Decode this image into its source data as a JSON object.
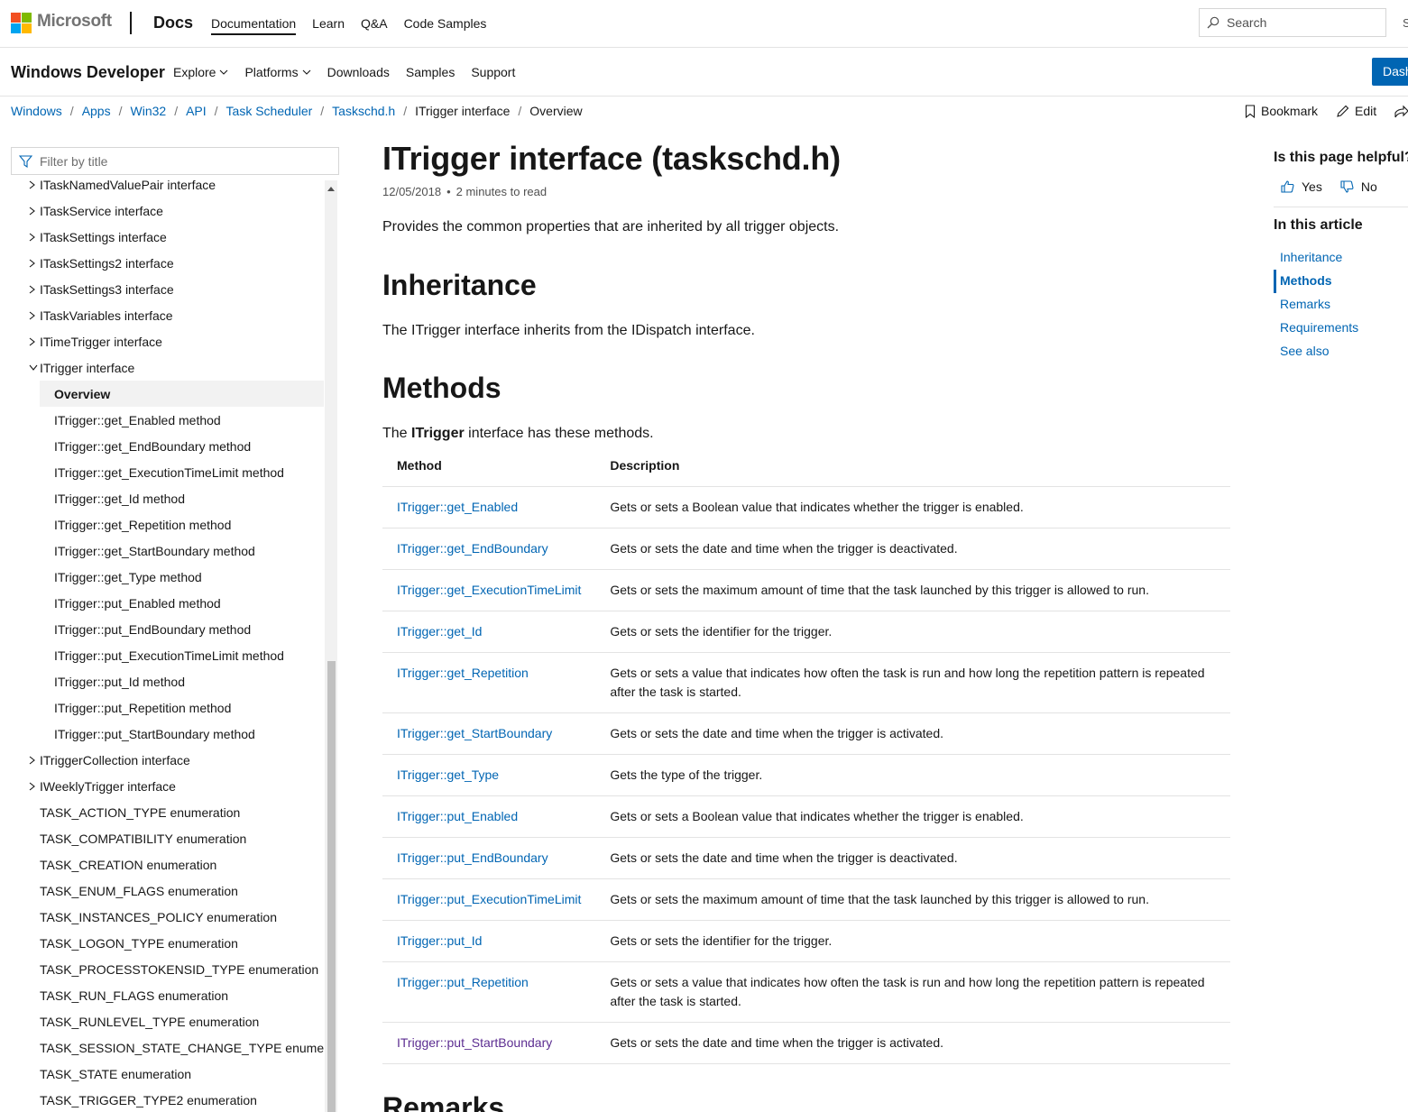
{
  "top_header": {
    "brand": "Microsoft",
    "product": "Docs",
    "nav": [
      "Documentation",
      "Learn",
      "Q&A",
      "Code Samples"
    ],
    "search_placeholder": "Search",
    "sign_in_partial": "S"
  },
  "sub_header": {
    "site_title": "Windows Developer",
    "nav": [
      {
        "label": "Explore",
        "dropdown": true
      },
      {
        "label": "Platforms",
        "dropdown": true
      },
      {
        "label": "Downloads",
        "dropdown": false
      },
      {
        "label": "Samples",
        "dropdown": false
      },
      {
        "label": "Support",
        "dropdown": false
      }
    ],
    "dashboard_label": "Dash"
  },
  "breadcrumb": [
    "Windows",
    "Apps",
    "Win32",
    "API",
    "Task Scheduler",
    "Taskschd.h",
    "ITrigger interface",
    "Overview"
  ],
  "actions": {
    "bookmark": "Bookmark",
    "edit": "Edit"
  },
  "toc": {
    "filter_placeholder": "Filter by title",
    "items": [
      {
        "label": "ITaskNamedValuePair interface",
        "level": 1,
        "expand": "collapsed"
      },
      {
        "label": "ITaskService interface",
        "level": 1,
        "expand": "collapsed"
      },
      {
        "label": "ITaskSettings interface",
        "level": 1,
        "expand": "collapsed"
      },
      {
        "label": "ITaskSettings2 interface",
        "level": 1,
        "expand": "collapsed"
      },
      {
        "label": "ITaskSettings3 interface",
        "level": 1,
        "expand": "collapsed"
      },
      {
        "label": "ITaskVariables interface",
        "level": 1,
        "expand": "collapsed"
      },
      {
        "label": "ITimeTrigger interface",
        "level": 1,
        "expand": "collapsed"
      },
      {
        "label": "ITrigger interface",
        "level": 1,
        "expand": "expanded"
      },
      {
        "label": "Overview",
        "level": 2,
        "selected": true
      },
      {
        "label": "ITrigger::get_Enabled method",
        "level": 2
      },
      {
        "label": "ITrigger::get_EndBoundary method",
        "level": 2
      },
      {
        "label": "ITrigger::get_ExecutionTimeLimit method",
        "level": 2
      },
      {
        "label": "ITrigger::get_Id method",
        "level": 2
      },
      {
        "label": "ITrigger::get_Repetition method",
        "level": 2
      },
      {
        "label": "ITrigger::get_StartBoundary method",
        "level": 2
      },
      {
        "label": "ITrigger::get_Type method",
        "level": 2
      },
      {
        "label": "ITrigger::put_Enabled method",
        "level": 2
      },
      {
        "label": "ITrigger::put_EndBoundary method",
        "level": 2
      },
      {
        "label": "ITrigger::put_ExecutionTimeLimit method",
        "level": 2
      },
      {
        "label": "ITrigger::put_Id method",
        "level": 2
      },
      {
        "label": "ITrigger::put_Repetition method",
        "level": 2
      },
      {
        "label": "ITrigger::put_StartBoundary method",
        "level": 2
      },
      {
        "label": "ITriggerCollection interface",
        "level": 1,
        "expand": "collapsed"
      },
      {
        "label": "IWeeklyTrigger interface",
        "level": 1,
        "expand": "collapsed"
      },
      {
        "label": "TASK_ACTION_TYPE enumeration",
        "level": 1,
        "expand": "none"
      },
      {
        "label": "TASK_COMPATIBILITY enumeration",
        "level": 1,
        "expand": "none"
      },
      {
        "label": "TASK_CREATION enumeration",
        "level": 1,
        "expand": "none"
      },
      {
        "label": "TASK_ENUM_FLAGS enumeration",
        "level": 1,
        "expand": "none"
      },
      {
        "label": "TASK_INSTANCES_POLICY enumeration",
        "level": 1,
        "expand": "none"
      },
      {
        "label": "TASK_LOGON_TYPE enumeration",
        "level": 1,
        "expand": "none"
      },
      {
        "label": "TASK_PROCESSTOKENSID_TYPE enumeration",
        "level": 1,
        "expand": "none"
      },
      {
        "label": "TASK_RUN_FLAGS enumeration",
        "level": 1,
        "expand": "none"
      },
      {
        "label": "TASK_RUNLEVEL_TYPE enumeration",
        "level": 1,
        "expand": "none"
      },
      {
        "label": "TASK_SESSION_STATE_CHANGE_TYPE enumeration",
        "level": 1,
        "expand": "none"
      },
      {
        "label": "TASK_STATE enumeration",
        "level": 1,
        "expand": "none"
      },
      {
        "label": "TASK_TRIGGER_TYPE2 enumeration",
        "level": 1,
        "expand": "none"
      }
    ]
  },
  "article": {
    "title": "ITrigger interface (taskschd.h)",
    "date": "12/05/2018",
    "read_time": "2 minutes to read",
    "lead": "Provides the common properties that are inherited by all trigger objects.",
    "inheritance_heading": "Inheritance",
    "inheritance_text": "The ITrigger interface inherits from the IDispatch interface.",
    "methods_heading": "Methods",
    "methods_intro_pre": "The ",
    "methods_intro_bold": "ITrigger",
    "methods_intro_post": " interface has these methods.",
    "table_headers": [
      "Method",
      "Description"
    ],
    "methods": [
      {
        "name": "ITrigger::get_Enabled",
        "desc": "Gets or sets a Boolean value that indicates whether the trigger is enabled."
      },
      {
        "name": "ITrigger::get_EndBoundary",
        "desc": "Gets or sets the date and time when the trigger is deactivated."
      },
      {
        "name": "ITrigger::get_ExecutionTimeLimit",
        "desc": "Gets or sets the maximum amount of time that the task launched by this trigger is allowed to run."
      },
      {
        "name": "ITrigger::get_Id",
        "desc": "Gets or sets the identifier for the trigger."
      },
      {
        "name": "ITrigger::get_Repetition",
        "desc": "Gets or sets a value that indicates how often the task is run and how long the repetition pattern is repeated after the task is started."
      },
      {
        "name": "ITrigger::get_StartBoundary",
        "desc": "Gets or sets the date and time when the trigger is activated."
      },
      {
        "name": "ITrigger::get_Type",
        "desc": "Gets the type of the trigger."
      },
      {
        "name": "ITrigger::put_Enabled",
        "desc": "Gets or sets a Boolean value that indicates whether the trigger is enabled."
      },
      {
        "name": "ITrigger::put_EndBoundary",
        "desc": "Gets or sets the date and time when the trigger is deactivated."
      },
      {
        "name": "ITrigger::put_ExecutionTimeLimit",
        "desc": "Gets or sets the maximum amount of time that the task launched by this trigger is allowed to run."
      },
      {
        "name": "ITrigger::put_Id",
        "desc": "Gets or sets the identifier for the trigger."
      },
      {
        "name": "ITrigger::put_Repetition",
        "desc": "Gets or sets a value that indicates how often the task is run and how long the repetition pattern is repeated after the task is started."
      },
      {
        "name": "ITrigger::put_StartBoundary",
        "desc": "Gets or sets the date and time when the trigger is activated.",
        "visited": true
      }
    ],
    "remarks_heading_partial": "Remarks"
  },
  "right_rail": {
    "helpful_heading": "Is this page helpful?",
    "yes": "Yes",
    "no": "No",
    "in_this_article": "In this article",
    "links": [
      {
        "label": "Inheritance",
        "active": false
      },
      {
        "label": "Methods",
        "active": true
      },
      {
        "label": "Remarks",
        "active": false
      },
      {
        "label": "Requirements",
        "active": false
      },
      {
        "label": "See also",
        "active": false
      }
    ]
  },
  "colors": {
    "link": "#0065b3",
    "visited_link": "#5c2d91",
    "text": "#171717",
    "dashboard_button": "#0065b3"
  }
}
